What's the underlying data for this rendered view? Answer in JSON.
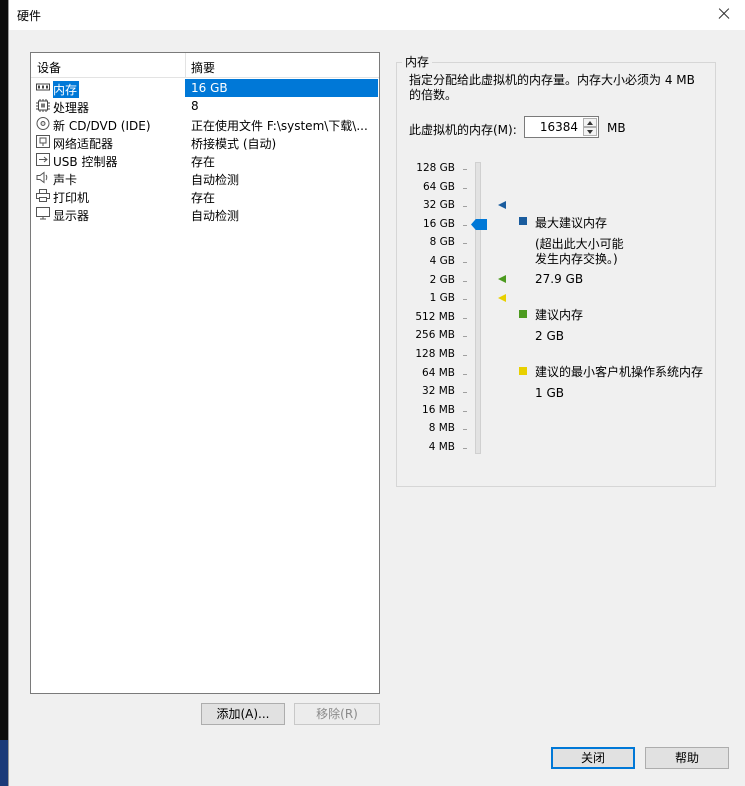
{
  "window": {
    "title": "硬件"
  },
  "device_list": {
    "headers": {
      "device": "设备",
      "summary": "摘要"
    },
    "rows": [
      {
        "name": "内存",
        "summary": "16 GB",
        "icon": "memory-icon",
        "selected": true
      },
      {
        "name": "处理器",
        "summary": "8",
        "icon": "processor-icon"
      },
      {
        "name": "新 CD/DVD (IDE)",
        "summary": "正在使用文件 F:\\system\\下载\\...",
        "icon": "cd-dvd-icon"
      },
      {
        "name": "网络适配器",
        "summary": "桥接模式 (自动)",
        "icon": "network-adapter-icon"
      },
      {
        "name": "USB 控制器",
        "summary": "存在",
        "icon": "usb-icon"
      },
      {
        "name": "声卡",
        "summary": "自动检测",
        "icon": "sound-icon"
      },
      {
        "name": "打印机",
        "summary": "存在",
        "icon": "printer-icon"
      },
      {
        "name": "显示器",
        "summary": "自动检测",
        "icon": "display-icon"
      }
    ],
    "add_button": "添加(A)...",
    "remove_button": "移除(R)"
  },
  "memory_panel": {
    "group_title": "内存",
    "description_line1": "指定分配给此虚拟机的内存量。内存大小必须为 4 MB",
    "description_line2": "的倍数。",
    "memory_label": "此虚拟机的内存(M):",
    "memory_value": "16384",
    "unit": "MB",
    "scale_labels": [
      "128 GB",
      "64 GB",
      "32 GB",
      "16 GB",
      "8 GB",
      "4 GB",
      "2 GB",
      "1 GB",
      "512 MB",
      "256 MB",
      "128 MB",
      "64 MB",
      "32 MB",
      "16 MB",
      "8 MB",
      "4 MB"
    ],
    "slider_value": "16 GB",
    "legend": {
      "max_title": "最大建议内存",
      "max_note_line1": "(超出此大小可能",
      "max_note_line2": "发生内存交换。)",
      "max_value": "27.9 GB",
      "rec_title": "建议内存",
      "rec_value": "2 GB",
      "min_title": "建议的最小客户机操作系统内存",
      "min_value": "1 GB"
    },
    "colors": {
      "max": "#1a5c9e",
      "recommended": "#4c9a1f",
      "minimum": "#e8d000",
      "accent": "#0078d7"
    }
  },
  "footer": {
    "close_button": "关闭",
    "help_button": "帮助"
  }
}
